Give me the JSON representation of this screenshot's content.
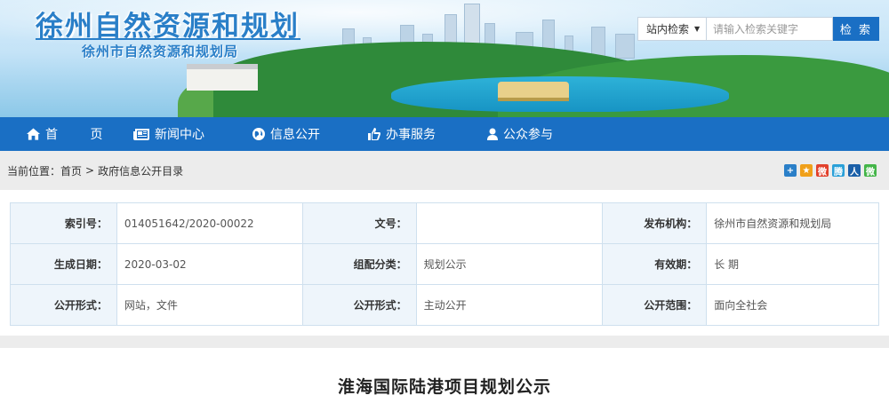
{
  "header": {
    "site_title": "徐州自然资源和规划",
    "site_subtitle": "徐州市自然资源和规划局"
  },
  "search": {
    "scope_label": "站内检索",
    "placeholder": "请输入检索关键字",
    "button_label": "检 索"
  },
  "nav": {
    "items": [
      {
        "label": "首 页",
        "icon": "home-icon"
      },
      {
        "label": "新闻中心",
        "icon": "newspaper-icon"
      },
      {
        "label": "信息公开",
        "icon": "globe-icon"
      },
      {
        "label": "办事服务",
        "icon": "thumbs-up-icon"
      },
      {
        "label": "公众参与",
        "icon": "user-icon"
      }
    ]
  },
  "breadcrumb": {
    "prefix": "当前位置：",
    "items": [
      "首页",
      "政府信息公开目录"
    ],
    "separator": ">"
  },
  "share_icons": [
    {
      "name": "plus-share-icon",
      "color": "#2a7fc8",
      "glyph": "+"
    },
    {
      "name": "qzone-share-icon",
      "color": "#f0a01a",
      "glyph": "★"
    },
    {
      "name": "weibo-share-icon",
      "color": "#e2412c",
      "glyph": "微"
    },
    {
      "name": "tencent-weibo-share-icon",
      "color": "#2aa0d8",
      "glyph": "腾"
    },
    {
      "name": "renren-share-icon",
      "color": "#1a5fa8",
      "glyph": "人"
    },
    {
      "name": "wechat-share-icon",
      "color": "#44b549",
      "glyph": "微"
    }
  ],
  "meta": {
    "rows": [
      [
        {
          "key": "索引号：",
          "value": "014051642/2020-00022"
        },
        {
          "key": "文号：",
          "value": ""
        },
        {
          "key": "发布机构：",
          "value": "徐州市自然资源和规划局"
        }
      ],
      [
        {
          "key": "生成日期：",
          "value": "2020-03-02"
        },
        {
          "key": "组配分类：",
          "value": "规划公示"
        },
        {
          "key": "有效期：",
          "value": "长 期"
        }
      ],
      [
        {
          "key": "公开形式：",
          "value": "网站，文件"
        },
        {
          "key": "公开形式：",
          "value": "主动公开"
        },
        {
          "key": "公开范围：",
          "value": "面向全社会"
        }
      ]
    ]
  },
  "article": {
    "title": "淮海国际陆港项目规划公示"
  },
  "colors": {
    "primary_blue": "#1a6fc4",
    "title_blue": "#2a7fc8",
    "label_bg": "#eef5fb"
  }
}
